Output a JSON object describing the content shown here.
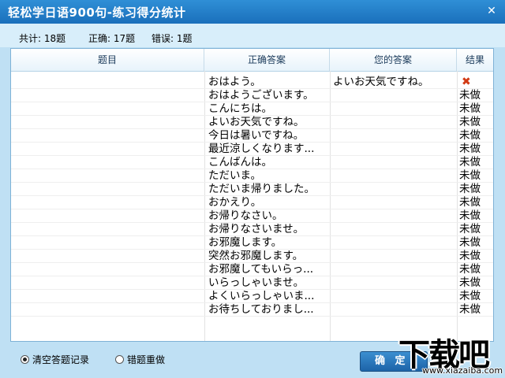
{
  "window": {
    "title": "轻松学日语900句-练习得分统计",
    "close_glyph": "✕"
  },
  "summary": {
    "total": "共计: 18题",
    "correct": "正确: 17题",
    "wrong": "错误: 1题"
  },
  "table": {
    "columns": [
      "题目",
      "正确答案",
      "您的答案",
      "结果"
    ],
    "rows": [
      {
        "question": "",
        "answer": "おはよう。",
        "yours": "よいお天気ですね。",
        "result": "✖"
      },
      {
        "question": "",
        "answer": "おはようございます。",
        "yours": "",
        "result": "未做"
      },
      {
        "question": "",
        "answer": "こんにちは。",
        "yours": "",
        "result": "未做"
      },
      {
        "question": "",
        "answer": "よいお天気ですね。",
        "yours": "",
        "result": "未做"
      },
      {
        "question": "",
        "answer": "今日は暑いですね。",
        "yours": "",
        "result": "未做"
      },
      {
        "question": "",
        "answer": "最近涼しくなります...",
        "yours": "",
        "result": "未做"
      },
      {
        "question": "",
        "answer": "こんばんは。",
        "yours": "",
        "result": "未做"
      },
      {
        "question": "",
        "answer": "ただいま。",
        "yours": "",
        "result": "未做"
      },
      {
        "question": "",
        "answer": "ただいま帰りました。",
        "yours": "",
        "result": "未做"
      },
      {
        "question": "",
        "answer": "おかえり。",
        "yours": "",
        "result": "未做"
      },
      {
        "question": "",
        "answer": "お帰りなさい。",
        "yours": "",
        "result": "未做"
      },
      {
        "question": "",
        "answer": "お帰りなさいませ。",
        "yours": "",
        "result": "未做"
      },
      {
        "question": "",
        "answer": "お邪魔します。",
        "yours": "",
        "result": "未做"
      },
      {
        "question": "",
        "answer": "突然お邪魔します。",
        "yours": "",
        "result": "未做"
      },
      {
        "question": "",
        "answer": "お邪魔してもいらっ...",
        "yours": "",
        "result": "未做"
      },
      {
        "question": "",
        "answer": "いらっしゃいませ。",
        "yours": "",
        "result": "未做"
      },
      {
        "question": "",
        "answer": "よくいらっしゃいま...",
        "yours": "",
        "result": "未做"
      },
      {
        "question": "",
        "answer": "お待ちしておりまし...",
        "yours": "",
        "result": "未做"
      }
    ]
  },
  "footer": {
    "radio_clear": "清空答题记录",
    "radio_redo": "错题重做",
    "ok_label": "确 定"
  },
  "watermark": {
    "big": "下载吧",
    "small": "www.xiazaiba.com"
  },
  "colors": {
    "titlebar": "#1a6fbb",
    "background": "#bfe0f4",
    "wrong_mark": "#d23a14"
  }
}
